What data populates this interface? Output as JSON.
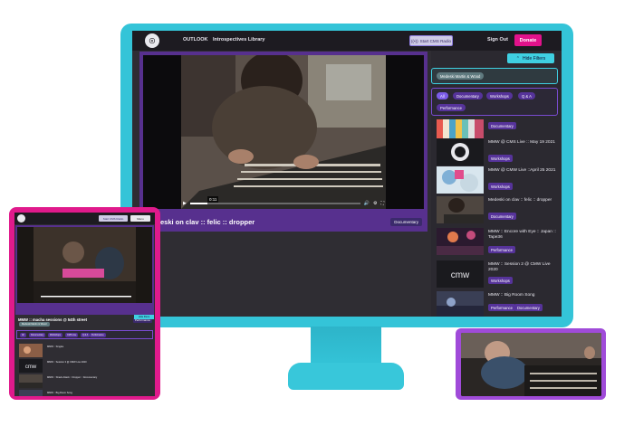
{
  "nav": {
    "brand": "OUTLOOK",
    "library": "Introspectives Library",
    "radio_button": "Start CMS Radio",
    "signout": "Sign Out",
    "donate": "Donate"
  },
  "player": {
    "title": "Medeski on clav :: felic :: dropper",
    "tag": "Documentary",
    "timestamp": "0:11",
    "progress": 0.1
  },
  "filters": {
    "hide_button": "Hide Filters",
    "active_chip": "Medeski Martin & Wood",
    "categories": [
      "All",
      "Documentary",
      "Workshops",
      "Q & A",
      "Performance"
    ]
  },
  "list": [
    {
      "title": "",
      "tags": [
        "Documentary"
      ]
    },
    {
      "title": "MMW @ CMS Live :: May 19 2021",
      "tags": [
        "Workshops"
      ]
    },
    {
      "title": "MMW @ CMW Live ::April 25 2021",
      "tags": [
        "Workshops"
      ]
    },
    {
      "title": "Medeski on clav :: felic :: dropper",
      "tags": [
        "Documentary"
      ]
    },
    {
      "title": "MMW :: Encore with Eye :: Japan :: Tape36",
      "tags": [
        "Performance"
      ]
    },
    {
      "title": "MMW :: Session 2 @ CMW Live 2020",
      "tags": [
        "Workshops"
      ]
    },
    {
      "title": "MMW :: Big Room Song",
      "tags": [
        "Performance",
        "Documentary"
      ]
    }
  ],
  "mobile": {
    "radio_button": "Start CMS Radio",
    "menu": "Menu",
    "title": "MMW :: macha sessions @ 54th street",
    "tag": "Performance",
    "hide_button": "Hide filters",
    "active_chip": "Medeski Martin & Wood",
    "categories": [
      "All",
      "Documentary",
      "Workshops",
      "CMS Live",
      "Q & A",
      "Performance"
    ],
    "list": [
      {
        "title": "MMW :: Singles"
      },
      {
        "title": "MMW :: Session 3 @ CMW Live 2020"
      },
      {
        "title": "MMW :: Shack Attack :: Dropper :: Documentary"
      },
      {
        "title": "MMW :: Big Room Song"
      }
    ]
  },
  "colors": {
    "monitor": "#34c4d8",
    "accent_purple": "#57308e",
    "donate": "#e1128b",
    "mobile_frame": "#e01a8c",
    "filter_cyan": "#3fd0e2"
  }
}
